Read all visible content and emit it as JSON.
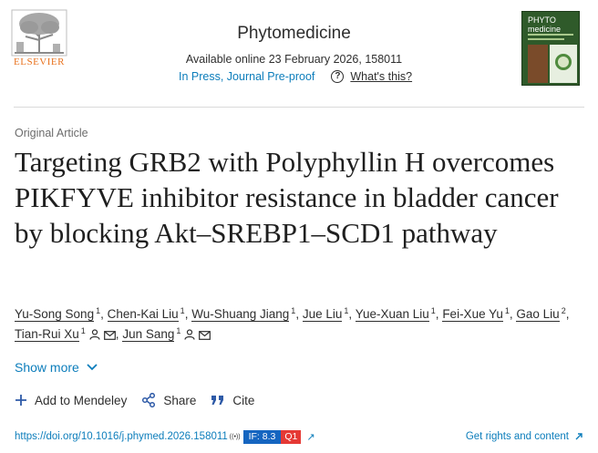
{
  "header": {
    "logo_text": "ELSEVIER",
    "journal_name": "Phytomedicine",
    "availability": "Available online 23 February 2026, 158011",
    "status": "In Press, Journal Pre-proof",
    "whats_this": "What's this?",
    "cover_title_1": "PHYTO",
    "cover_title_2": "medicine"
  },
  "article": {
    "type": "Original Article",
    "title": "Targeting GRB2 with Polyphyllin H overcomes PIKFYVE inhibitor resistance in bladder cancer by blocking Akt–SREBP1–SCD1 pathway"
  },
  "authors": [
    {
      "name": "Yu-Song Song",
      "sup": "1",
      "person": false,
      "mail": false,
      "sep": ","
    },
    {
      "name": "Chen-Kai Liu",
      "sup": "1",
      "person": false,
      "mail": false,
      "sep": ","
    },
    {
      "name": "Wu-Shuang Jiang",
      "sup": "1",
      "person": false,
      "mail": false,
      "sep": ","
    },
    {
      "name": "Jue Liu",
      "sup": "1",
      "person": false,
      "mail": false,
      "sep": ","
    },
    {
      "name": "Yue-Xuan Liu",
      "sup": "1",
      "person": false,
      "mail": false,
      "sep": ","
    },
    {
      "name": "Fei-Xue Yu",
      "sup": "1",
      "person": false,
      "mail": false,
      "sep": ","
    },
    {
      "name": "Gao Liu",
      "sup": "2",
      "person": false,
      "mail": false,
      "sep": ","
    },
    {
      "name": "Tian-Rui Xu",
      "sup": "1",
      "person": true,
      "mail": true,
      "sep": ","
    },
    {
      "name": "Jun Sang",
      "sup": "1",
      "person": true,
      "mail": true,
      "sep": ""
    }
  ],
  "show_more": "Show more",
  "actions": {
    "mendeley": "Add to Mendeley",
    "share": "Share",
    "cite": "Cite"
  },
  "footer": {
    "doi": "https://doi.org/10.1016/j.phymed.2026.158011",
    "impact_factor": "IF: 8.3",
    "quartile": "Q1",
    "rights": "Get rights and content"
  },
  "colors": {
    "link": "#0c7dbb",
    "elsevier_orange": "#e9711c",
    "if_badge": "#1565c0",
    "q_badge": "#e53935"
  }
}
